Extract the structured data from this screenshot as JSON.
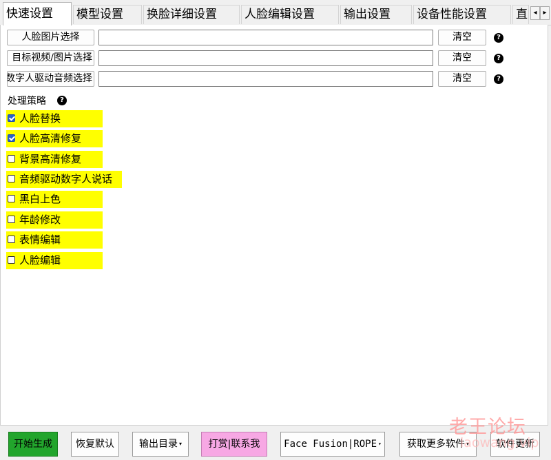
{
  "tabs": [
    {
      "label": "快速设置",
      "active": true
    },
    {
      "label": "模型设置",
      "active": false
    },
    {
      "label": "换脸详细设置",
      "active": false
    },
    {
      "label": "人脸编辑设置",
      "active": false
    },
    {
      "label": "输出设置",
      "active": false
    },
    {
      "label": "设备性能设置",
      "active": false
    },
    {
      "label": "直",
      "active": false
    }
  ],
  "tab_scroll": {
    "left": "◂",
    "right": "▸"
  },
  "inputs": [
    {
      "button": "人脸图片选择",
      "value": "",
      "clear": "清空",
      "help": "?"
    },
    {
      "button": "目标视频/图片选择",
      "value": "",
      "clear": "清空",
      "help": "?"
    },
    {
      "button": "数字人驱动音频选择",
      "value": "",
      "clear": "清空",
      "help": "?"
    }
  ],
  "strategy": {
    "label": "处理策略",
    "help": "?",
    "options": [
      {
        "label": "人脸替换",
        "checked": true
      },
      {
        "label": "人脸高清修复",
        "checked": true
      },
      {
        "label": "背景高清修复",
        "checked": false
      },
      {
        "label": "音频驱动数字人说话",
        "checked": false
      },
      {
        "label": "黑白上色",
        "checked": false
      },
      {
        "label": "年龄修改",
        "checked": false
      },
      {
        "label": "表情编辑",
        "checked": false
      },
      {
        "label": "人脸编辑",
        "checked": false
      }
    ]
  },
  "bottom": {
    "start": "开始生成",
    "reset": "恢复默认",
    "output_dir": "输出目录",
    "donate": "打赏|联系我",
    "engine": "Face Fusion|ROPE",
    "more": "获取更多软件",
    "update": "软件更新",
    "caret": "▾"
  },
  "watermark": {
    "cn": "老王论坛",
    "en": "laowang.vip"
  },
  "colors": {
    "highlight": "#ffff00",
    "start_button": "#22a52c",
    "donate_button": "#f7a8e4",
    "checkbox": "#2a63c9",
    "watermark": "#ff9c9c"
  }
}
